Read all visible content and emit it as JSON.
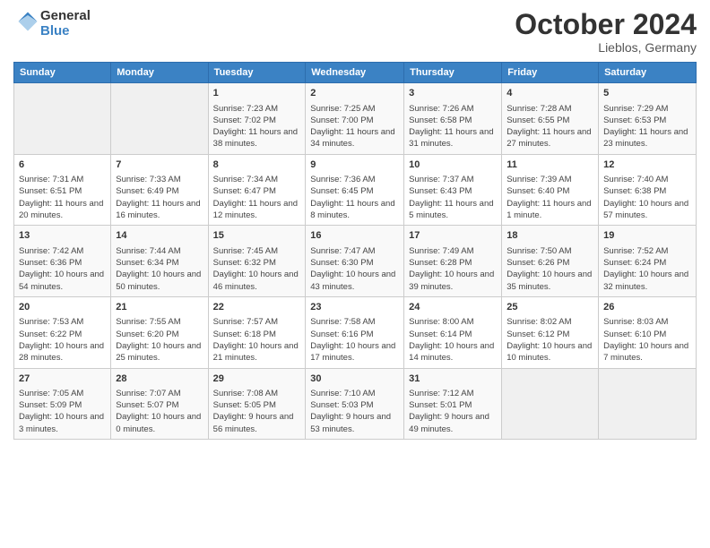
{
  "header": {
    "logo_text_general": "General",
    "logo_text_blue": "Blue",
    "month": "October 2024",
    "location": "Lieblos, Germany"
  },
  "columns": [
    "Sunday",
    "Monday",
    "Tuesday",
    "Wednesday",
    "Thursday",
    "Friday",
    "Saturday"
  ],
  "weeks": [
    [
      {
        "day": "",
        "empty": true
      },
      {
        "day": "",
        "empty": true
      },
      {
        "day": "1",
        "sunrise": "7:23 AM",
        "sunset": "7:02 PM",
        "daylight": "11 hours and 38 minutes."
      },
      {
        "day": "2",
        "sunrise": "7:25 AM",
        "sunset": "7:00 PM",
        "daylight": "11 hours and 34 minutes."
      },
      {
        "day": "3",
        "sunrise": "7:26 AM",
        "sunset": "6:58 PM",
        "daylight": "11 hours and 31 minutes."
      },
      {
        "day": "4",
        "sunrise": "7:28 AM",
        "sunset": "6:55 PM",
        "daylight": "11 hours and 27 minutes."
      },
      {
        "day": "5",
        "sunrise": "7:29 AM",
        "sunset": "6:53 PM",
        "daylight": "11 hours and 23 minutes."
      }
    ],
    [
      {
        "day": "6",
        "sunrise": "7:31 AM",
        "sunset": "6:51 PM",
        "daylight": "11 hours and 20 minutes."
      },
      {
        "day": "7",
        "sunrise": "7:33 AM",
        "sunset": "6:49 PM",
        "daylight": "11 hours and 16 minutes."
      },
      {
        "day": "8",
        "sunrise": "7:34 AM",
        "sunset": "6:47 PM",
        "daylight": "11 hours and 12 minutes."
      },
      {
        "day": "9",
        "sunrise": "7:36 AM",
        "sunset": "6:45 PM",
        "daylight": "11 hours and 8 minutes."
      },
      {
        "day": "10",
        "sunrise": "7:37 AM",
        "sunset": "6:43 PM",
        "daylight": "11 hours and 5 minutes."
      },
      {
        "day": "11",
        "sunrise": "7:39 AM",
        "sunset": "6:40 PM",
        "daylight": "11 hours and 1 minute."
      },
      {
        "day": "12",
        "sunrise": "7:40 AM",
        "sunset": "6:38 PM",
        "daylight": "10 hours and 57 minutes."
      }
    ],
    [
      {
        "day": "13",
        "sunrise": "7:42 AM",
        "sunset": "6:36 PM",
        "daylight": "10 hours and 54 minutes."
      },
      {
        "day": "14",
        "sunrise": "7:44 AM",
        "sunset": "6:34 PM",
        "daylight": "10 hours and 50 minutes."
      },
      {
        "day": "15",
        "sunrise": "7:45 AM",
        "sunset": "6:32 PM",
        "daylight": "10 hours and 46 minutes."
      },
      {
        "day": "16",
        "sunrise": "7:47 AM",
        "sunset": "6:30 PM",
        "daylight": "10 hours and 43 minutes."
      },
      {
        "day": "17",
        "sunrise": "7:49 AM",
        "sunset": "6:28 PM",
        "daylight": "10 hours and 39 minutes."
      },
      {
        "day": "18",
        "sunrise": "7:50 AM",
        "sunset": "6:26 PM",
        "daylight": "10 hours and 35 minutes."
      },
      {
        "day": "19",
        "sunrise": "7:52 AM",
        "sunset": "6:24 PM",
        "daylight": "10 hours and 32 minutes."
      }
    ],
    [
      {
        "day": "20",
        "sunrise": "7:53 AM",
        "sunset": "6:22 PM",
        "daylight": "10 hours and 28 minutes."
      },
      {
        "day": "21",
        "sunrise": "7:55 AM",
        "sunset": "6:20 PM",
        "daylight": "10 hours and 25 minutes."
      },
      {
        "day": "22",
        "sunrise": "7:57 AM",
        "sunset": "6:18 PM",
        "daylight": "10 hours and 21 minutes."
      },
      {
        "day": "23",
        "sunrise": "7:58 AM",
        "sunset": "6:16 PM",
        "daylight": "10 hours and 17 minutes."
      },
      {
        "day": "24",
        "sunrise": "8:00 AM",
        "sunset": "6:14 PM",
        "daylight": "10 hours and 14 minutes."
      },
      {
        "day": "25",
        "sunrise": "8:02 AM",
        "sunset": "6:12 PM",
        "daylight": "10 hours and 10 minutes."
      },
      {
        "day": "26",
        "sunrise": "8:03 AM",
        "sunset": "6:10 PM",
        "daylight": "10 hours and 7 minutes."
      }
    ],
    [
      {
        "day": "27",
        "sunrise": "7:05 AM",
        "sunset": "5:09 PM",
        "daylight": "10 hours and 3 minutes."
      },
      {
        "day": "28",
        "sunrise": "7:07 AM",
        "sunset": "5:07 PM",
        "daylight": "10 hours and 0 minutes."
      },
      {
        "day": "29",
        "sunrise": "7:08 AM",
        "sunset": "5:05 PM",
        "daylight": "9 hours and 56 minutes."
      },
      {
        "day": "30",
        "sunrise": "7:10 AM",
        "sunset": "5:03 PM",
        "daylight": "9 hours and 53 minutes."
      },
      {
        "day": "31",
        "sunrise": "7:12 AM",
        "sunset": "5:01 PM",
        "daylight": "9 hours and 49 minutes."
      },
      {
        "day": "",
        "empty": true
      },
      {
        "day": "",
        "empty": true
      }
    ]
  ]
}
